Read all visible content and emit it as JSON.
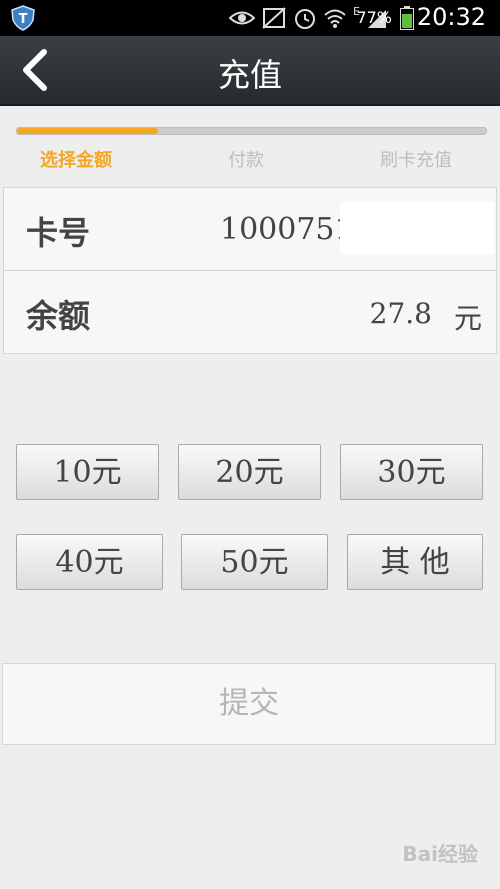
{
  "status_bar": {
    "battery_percent": "77%",
    "time": "20:32",
    "network_label": "E",
    "icons": [
      "shield-app-icon",
      "eye-icon",
      "nfc-off-icon",
      "alarm-icon",
      "wifi-icon",
      "signal-icon",
      "battery-icon"
    ]
  },
  "header": {
    "title": "充值",
    "back_icon": "chevron-left-icon"
  },
  "progress": {
    "fraction": 0.3,
    "accent_color": "#f5a623",
    "steps": [
      {
        "label": "选择金额",
        "active": true
      },
      {
        "label": "付款",
        "active": false
      },
      {
        "label": "刷卡充值",
        "active": false
      }
    ]
  },
  "info": {
    "card_label": "卡号",
    "card_number": "10007510",
    "balance_label": "余额",
    "balance_value": "27.8",
    "balance_unit": "元"
  },
  "amounts": [
    {
      "label": "10元"
    },
    {
      "label": "20元"
    },
    {
      "label": "30元"
    },
    {
      "label": "40元"
    },
    {
      "label": "50元"
    },
    {
      "label": "其 他"
    }
  ],
  "submit_label": "提交",
  "watermark": "Bai经验"
}
